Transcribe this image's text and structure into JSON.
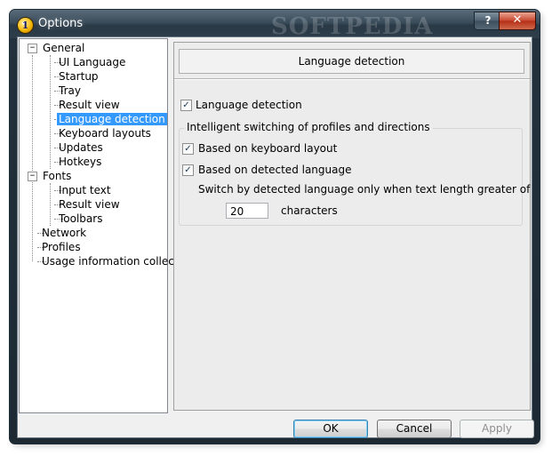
{
  "window": {
    "title": "Options",
    "watermark": "SOFTPEDIA",
    "help_glyph": "?",
    "close_glyph": "✕",
    "app_icon_glyph": "1"
  },
  "tree": {
    "general": "General",
    "general_children": [
      "UI Language",
      "Startup",
      "Tray",
      "Result view",
      "Language detection",
      "Keyboard layouts",
      "Updates",
      "Hotkeys"
    ],
    "fonts": "Fonts",
    "fonts_children": [
      "Input text",
      "Result view",
      "Toolbars"
    ],
    "network": "Network",
    "profiles": "Profiles",
    "usage": "Usage information collecting",
    "selected": "Language detection",
    "expand_glyph": "−"
  },
  "panel": {
    "header": "Language detection",
    "language_detection": {
      "label": "Language detection",
      "checked": true
    },
    "group_title": "Intelligent switching of profiles and directions",
    "keyboard_layout": {
      "label": "Based on keyboard layout",
      "checked": true
    },
    "detected_language": {
      "label": "Based on detected language",
      "checked": true
    },
    "switch_text": "Switch by detected language only when text length greater of",
    "length_value": "20",
    "characters_label": "characters",
    "check_glyph": "✓"
  },
  "buttons": {
    "ok": "OK",
    "cancel": "Cancel",
    "apply": "Apply"
  }
}
